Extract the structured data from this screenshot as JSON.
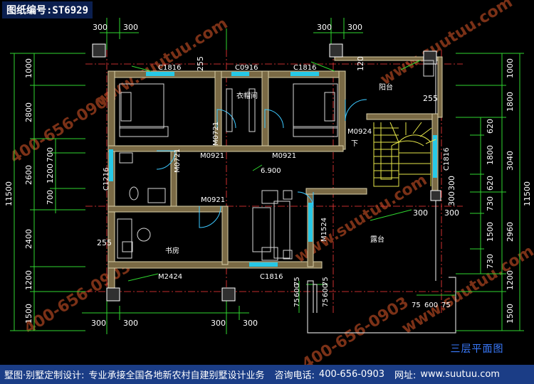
{
  "header": {
    "drawing_code": "图纸编号:ST6929"
  },
  "title": "三层平面图",
  "footer": {
    "company": "墅图·别墅定制设计:",
    "slogan": "专业承接全国各地新农村自建别墅设计业务",
    "phone_label": "咨询电话:",
    "phone": "400-656-0903",
    "site_label": "网址:",
    "site": "www.suutuu.com"
  },
  "watermarks": [
    "www.suutuu.com",
    "400-656-0903"
  ],
  "rooms": {
    "closet": "衣帽间",
    "balcony": "阳台",
    "terrace": "露台",
    "study": "书房",
    "stair_down": "下"
  },
  "openings": {
    "window_top_left": "C1816",
    "window_top_mid": "C0916",
    "window_top_right": "C1816",
    "window_left": "C1216",
    "window_bottom": "C1816",
    "window_right": "C1816",
    "door_closet": "M0721",
    "door_bath": "M0721",
    "door_bed_left": "M0921",
    "door_bed_right": "M0921",
    "door_stair": "M0924",
    "door_study": "M0921",
    "door_terrace": "M1524",
    "door_balcony_study": "M2424",
    "elevation": "6.900"
  },
  "dims": {
    "top": [
      "300",
      "300",
      "300",
      "300"
    ],
    "bottom": [
      "300",
      "300",
      "300",
      "300"
    ],
    "left_outer": "11500",
    "left_mid": [
      "1000",
      "2800",
      "2600",
      "2400",
      "1200",
      "1500"
    ],
    "left_inner": [
      "700",
      "1200",
      "700"
    ],
    "right_outer": "11500",
    "right_mid": [
      "1000",
      "1800",
      "3040",
      "2960",
      "1200",
      "1500"
    ],
    "right_inner": [
      "620",
      "1800",
      "620",
      "730",
      "1500",
      "730"
    ],
    "misc": {
      "d255a": "255",
      "d255b": "255",
      "d255c": "255",
      "d120": "120",
      "d300a": "300",
      "d300b": "300",
      "d300c": "300",
      "d300d": "300",
      "b75a": "75",
      "b600a": "600",
      "b75b": "75",
      "b75c": "75",
      "b600b": "600",
      "b75d": "75",
      "r75a": "75",
      "r600": "600",
      "r75b": "75"
    }
  },
  "colors": {
    "background": "#000000",
    "wall": "#7a6a45",
    "wall_edge": "#d8cfa8",
    "dimension": "#2fd62f",
    "axis": "#ff3b3b",
    "window": "#27c9e6",
    "door": "#3cc8ff",
    "text": "#ffffff",
    "stair": "#e6e64a",
    "furniture": "#d8d8d8",
    "footer_bg": "#1b3d86",
    "watermark": "#e05a2a"
  }
}
